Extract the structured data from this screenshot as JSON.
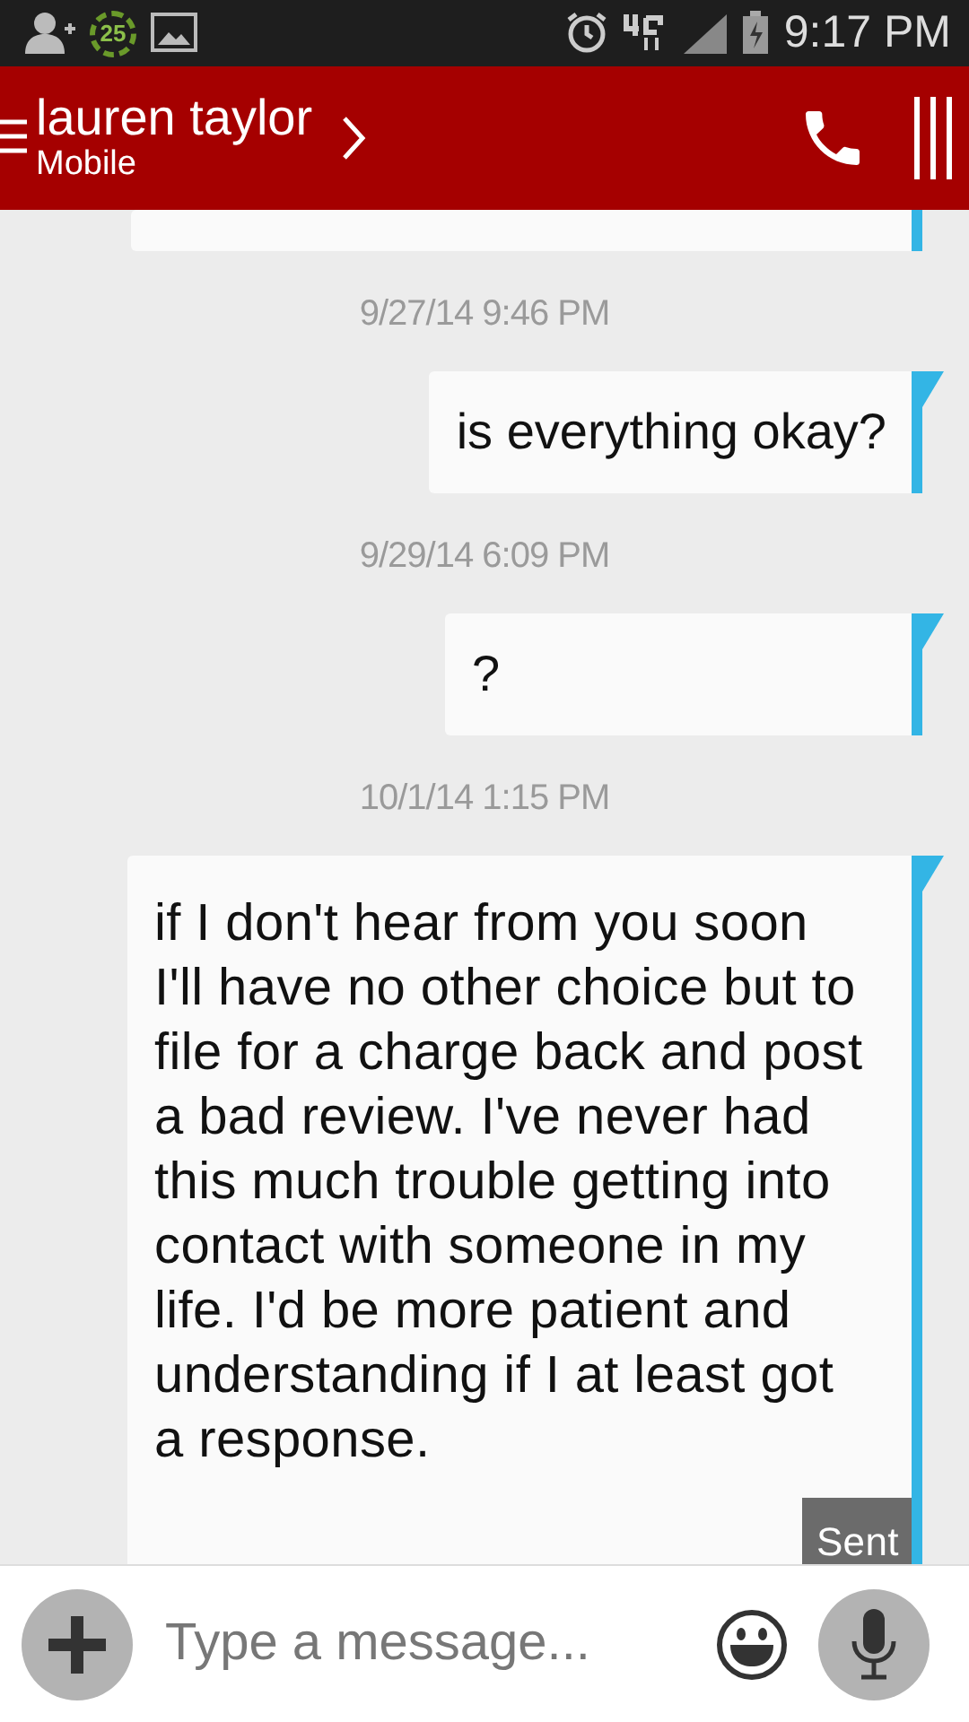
{
  "status_bar": {
    "notification_count": "25",
    "time": "9:17 PM"
  },
  "header": {
    "contact_name": "lauren taylor",
    "number_type": "Mobile"
  },
  "messages": [
    {
      "kind": "cut_bubble"
    },
    {
      "kind": "timestamp",
      "text": "9/27/14 9:46 PM"
    },
    {
      "kind": "message",
      "text": "is everything okay?"
    },
    {
      "kind": "timestamp",
      "text": "9/29/14 6:09 PM"
    },
    {
      "kind": "message",
      "text": "?"
    },
    {
      "kind": "timestamp",
      "text": "10/1/14 1:15 PM"
    },
    {
      "kind": "message",
      "text": "if I don't hear from you soon I'll have no other choice but to file for a charge back and post a bad review. I've never had this much trouble getting into contact with someone in my life. I'd be more patient and understanding if I at least got a response.",
      "status": "Sent"
    }
  ],
  "composer": {
    "placeholder": "Type a message..."
  }
}
